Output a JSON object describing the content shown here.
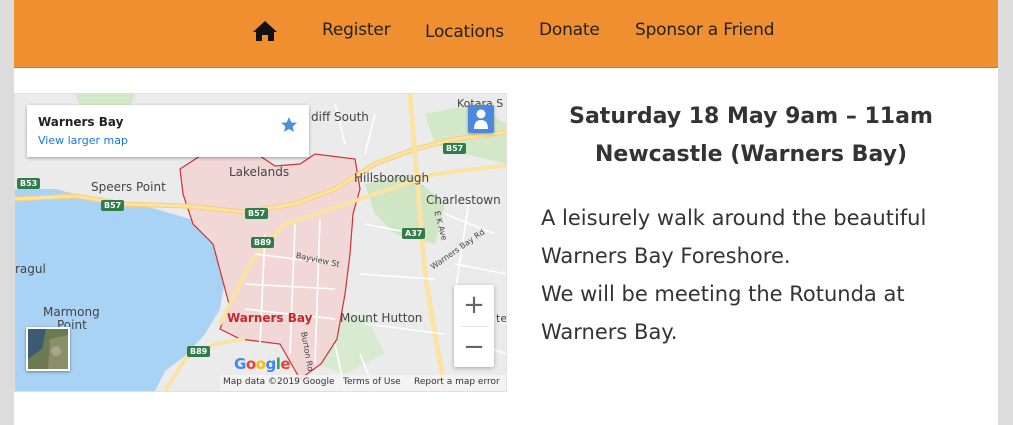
{
  "nav": {
    "home_icon": "home-icon",
    "links": [
      "Register",
      "Locations",
      "Donate",
      "Sponsor a Friend"
    ],
    "color": "#ef8f2f"
  },
  "map": {
    "place_title": "Warners Bay",
    "view_larger": "View larger map",
    "zoom_in": "+",
    "zoom_out": "−",
    "labels": {
      "kotara": "Kotara S",
      "adamstown": "diff South",
      "lakelands": "Lakelands",
      "hillsborough": "Hillsborough",
      "speers_point": "Speers Point",
      "charlestown": "Charlestown",
      "ek_ave": "E K Ave",
      "warners_bay_rd": "Warners Bay Rd",
      "bayview_st": "Bayview St",
      "ragul": "ragul",
      "marmong": "Marmong",
      "point": "Point",
      "warners_bay": "Warners Bay",
      "mount_hutton": "Mount Hutton",
      "burton_rd": "Burton Rd",
      "te": "te"
    },
    "road_badges": {
      "b53": "B53",
      "b57a": "B57",
      "b57b": "B57",
      "b57c": "B57",
      "b89a": "B89",
      "b89b": "B89",
      "a37": "A37"
    },
    "google": [
      "G",
      "o",
      "o",
      "g",
      "l",
      "e"
    ],
    "attribution": {
      "data": "Map data ©2019 Google",
      "terms": "Terms of Use",
      "report": "Report a map error"
    }
  },
  "event": {
    "date": "Saturday 18 May 9am – 11am",
    "location": "Newcastle (Warners Bay)",
    "description_lines": [
      "A leisurely walk around the beautiful",
      "Warners Bay Foreshore.",
      "We will be meeting the Rotunda at",
      "Warners Bay."
    ]
  }
}
